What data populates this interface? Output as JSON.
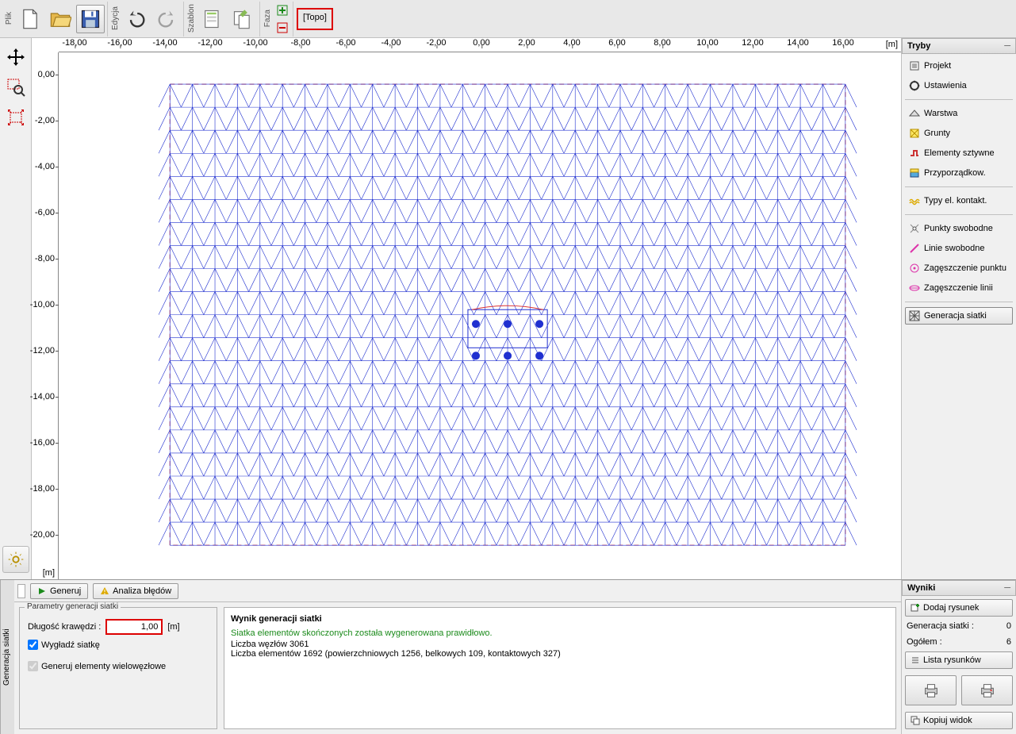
{
  "toolbar": {
    "plik": "Plik",
    "edycja": "Edycja",
    "szablon": "Szablon",
    "faza": "Faza",
    "topo": "[Topo]"
  },
  "ruler": {
    "h": [
      "-18,00",
      "-16,00",
      "-14,00",
      "-12,00",
      "-10,00",
      "-8,00",
      "-6,00",
      "-4,00",
      "-2,00",
      "0,00",
      "2,00",
      "4,00",
      "6,00",
      "8,00",
      "10,00",
      "12,00",
      "14,00",
      "16,00"
    ],
    "hm": "[m]",
    "v": [
      "0,00",
      "-2,00",
      "-4,00",
      "-6,00",
      "-8,00",
      "-10,00",
      "-12,00",
      "-14,00",
      "-16,00",
      "-18,00",
      "-20,00"
    ],
    "vm": "[m]"
  },
  "side": {
    "title": "Tryby",
    "items": [
      {
        "label": "Projekt"
      },
      {
        "label": "Ustawienia"
      },
      {
        "sep": true
      },
      {
        "label": "Warstwa"
      },
      {
        "label": "Grunty"
      },
      {
        "label": "Elementy sztywne"
      },
      {
        "label": "Przyporządkow."
      },
      {
        "sep": true
      },
      {
        "label": "Typy el. kontakt."
      },
      {
        "sep": true
      },
      {
        "label": "Punkty swobodne"
      },
      {
        "label": "Linie swobodne"
      },
      {
        "label": "Zagęszczenie punktu"
      },
      {
        "label": "Zagęszczenie linii"
      },
      {
        "sep": true
      },
      {
        "label": "Generacja siatki",
        "sel": true
      }
    ]
  },
  "bottom": {
    "sidelabel": "Generacja siatki",
    "tabs": {
      "gen": "Generuj",
      "err": "Analiza błędów"
    },
    "params": {
      "legend": "Parametry generacji siatki",
      "edge_label": "Długość krawędzi :",
      "edge_value": "1,00",
      "edge_unit": "[m]",
      "smooth": "Wygładź siatkę",
      "multi": "Generuj elementy wielowęzłowe"
    },
    "result": {
      "title": "Wynik generacji siatki",
      "ok": "Siatka elementów skończonych została wygenerowana prawidłowo.",
      "l1": "Liczba węzłów 3061",
      "l2": "Liczba elementów 1692 (powierzchniowych 1256, belkowych 109, kontaktowych 327)"
    }
  },
  "results": {
    "title": "Wyniki",
    "add": "Dodaj rysunek",
    "gen_l": "Generacja siatki :",
    "gen_v": "0",
    "tot_l": "Ogółem :",
    "tot_v": "6",
    "list": "Lista rysunków",
    "copy": "Kopiuj widok"
  }
}
